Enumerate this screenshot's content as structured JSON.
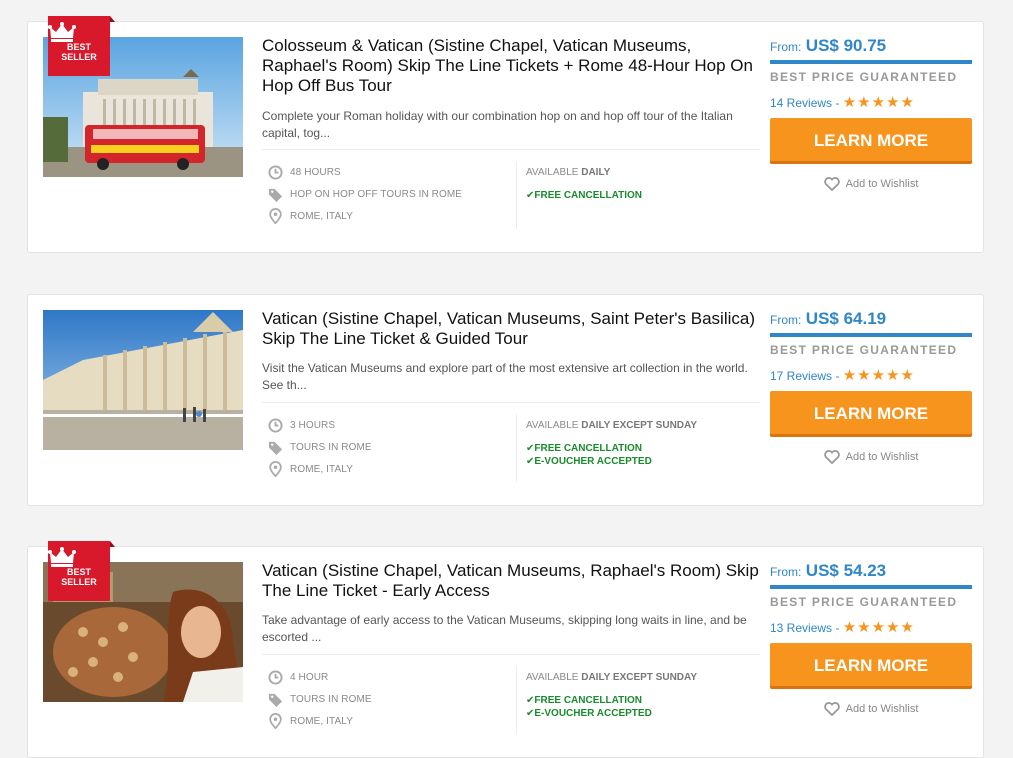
{
  "listings": [
    {
      "best_seller": true,
      "badge_line1": "BEST",
      "badge_line2": "SELLER",
      "title": "Colosseum & Vatican (Sistine Chapel, Vatican Museums, Raphael's Room) Skip The Line Tickets + Rome 48-Hour Hop On Hop Off Bus Tour",
      "description": "Complete your Roman holiday with our combination hop on and hop off tour of the Italian capital, tog...",
      "duration": "48 HOURS",
      "category": "HOP ON HOP OFF TOURS IN ROME",
      "location": "ROME, ITALY",
      "available_label": "AVAILABLE",
      "available_value": "DAILY",
      "features": [
        "FREE CANCELLATION"
      ],
      "from_label": "From:",
      "price": "US$ 90.75",
      "guarantee": "BEST PRICE GUARANTEED",
      "reviews": "14 Reviews -",
      "stars": "★★★★★",
      "cta": "LEARN MORE",
      "wishlist": "Add to Wishlist"
    },
    {
      "best_seller": false,
      "title": "Vatican (Sistine Chapel, Vatican Museums, Saint Peter's Basilica) Skip The Line Ticket & Guided Tour",
      "description": "Visit the Vatican Museums and explore part of the most extensive art collection in the world. See th...",
      "duration": "3 HOURS",
      "category": "TOURS IN ROME",
      "location": "ROME, ITALY",
      "available_label": "AVAILABLE",
      "available_value": "DAILY EXCEPT SUNDAY",
      "features": [
        "FREE CANCELLATION",
        "E-VOUCHER ACCEPTED"
      ],
      "from_label": "From:",
      "price": "US$ 64.19",
      "guarantee": "BEST PRICE GUARANTEED",
      "reviews": "17 Reviews -",
      "stars": "★★★★★",
      "cta": "LEARN MORE",
      "wishlist": "Add to Wishlist"
    },
    {
      "best_seller": true,
      "badge_line1": "BEST",
      "badge_line2": "SELLER",
      "title": "Vatican (Sistine Chapel, Vatican Museums, Raphael's Room) Skip The Line Ticket - Early Access",
      "description": "Take advantage of early access to the Vatican Museums, skipping long waits in line, and be escorted ...",
      "duration": "4 HOUR",
      "category": "TOURS IN ROME",
      "location": "ROME, ITALY",
      "available_label": "AVAILABLE",
      "available_value": "DAILY EXCEPT SUNDAY",
      "features": [
        "FREE CANCELLATION",
        "E-VOUCHER ACCEPTED"
      ],
      "from_label": "From:",
      "price": "US$ 54.23",
      "guarantee": "BEST PRICE GUARANTEED",
      "reviews": "13 Reviews -",
      "stars": "★★★★★",
      "cta": "LEARN MORE",
      "wishlist": "Add to Wishlist"
    }
  ],
  "colors": {
    "accent_blue": "#2f86c8",
    "cta_orange": "#f7941d",
    "badge_red": "#d7192b",
    "check_green": "#1b8a2e"
  }
}
